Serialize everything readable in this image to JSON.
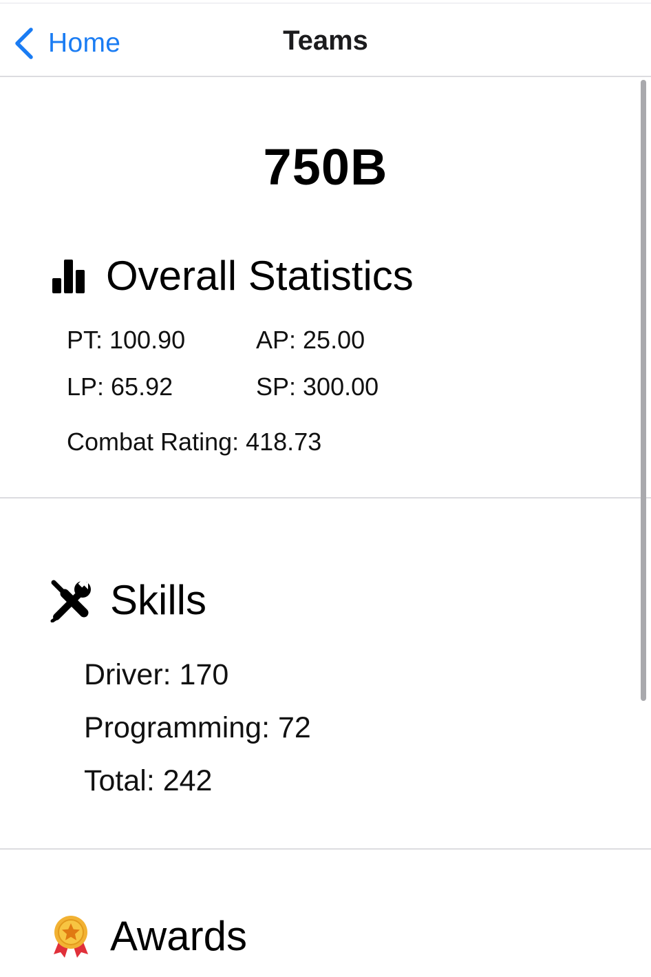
{
  "nav": {
    "back_label": "Home",
    "title": "Teams"
  },
  "team": {
    "number": "750B"
  },
  "overall_statistics": {
    "title": "Overall Statistics",
    "pt": "PT: 100.90",
    "ap": "AP: 25.00",
    "lp": "LP: 65.92",
    "sp": "SP: 300.00",
    "combat_rating": "Combat Rating: 418.73"
  },
  "skills": {
    "title": "Skills",
    "driver": "Driver: 170",
    "programming": "Programming: 72",
    "total": "Total: 242"
  },
  "awards": {
    "title": "Awards"
  },
  "colors": {
    "accent": "#1a7cf3",
    "divider": "#dcdce0",
    "scrollbar": "#a9a9ad"
  },
  "icons": {
    "back": "chevron-left-icon",
    "statistics": "bar-chart-icon",
    "skills": "wrench-screwdriver-icon",
    "awards": "medal-icon"
  }
}
